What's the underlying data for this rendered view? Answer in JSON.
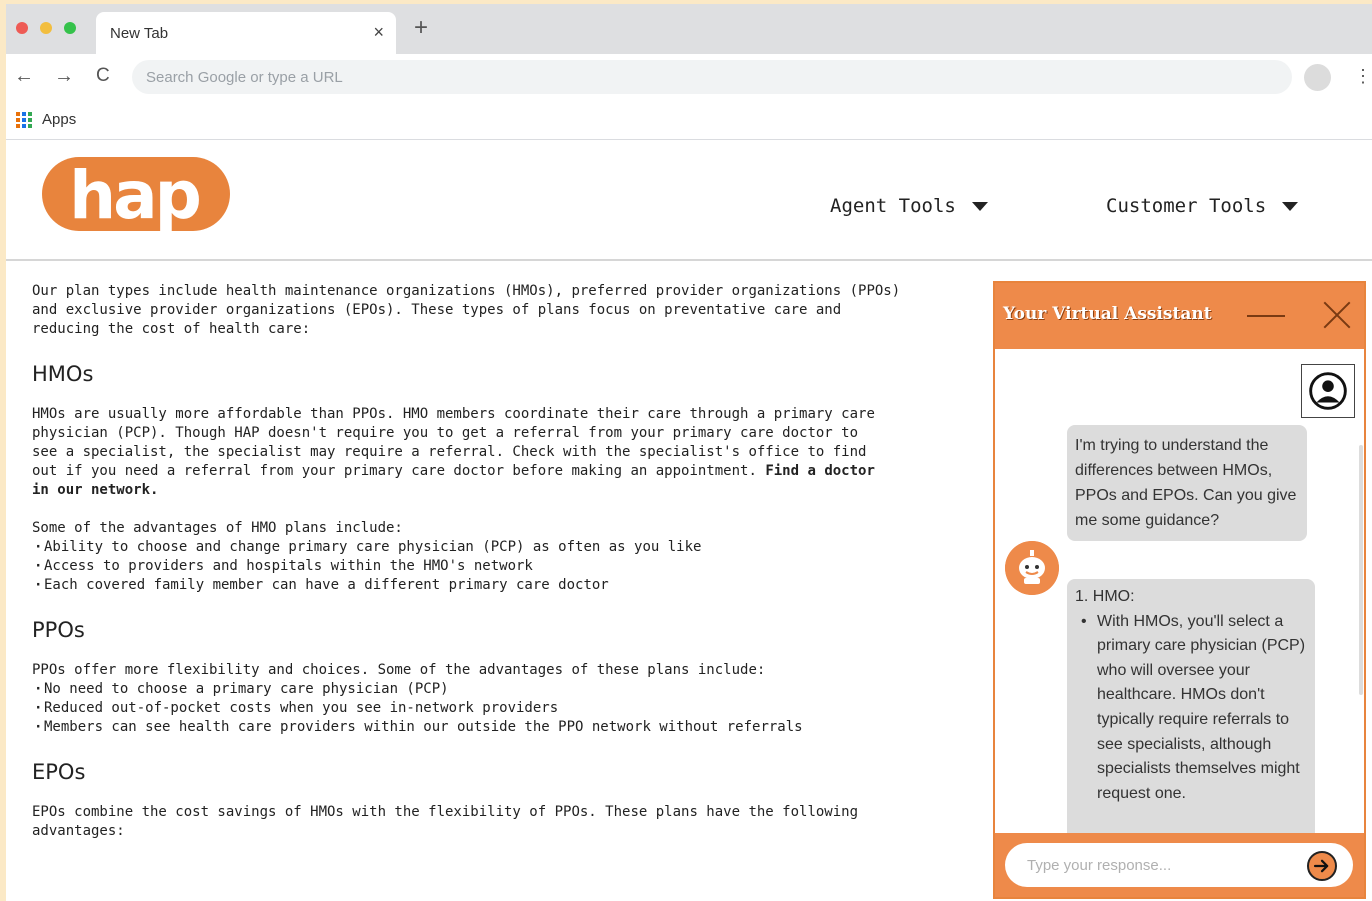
{
  "browser": {
    "tab_title": "New Tab",
    "tab_close": "×",
    "new_tab": "+",
    "back": "←",
    "forward": "→",
    "reload": "C",
    "omnibox_placeholder": "Search Google or type a URL",
    "menu": "⋮",
    "bookmarks_apps": "Apps"
  },
  "site": {
    "logo_text": "hap",
    "brand_color": "#ee8a4a",
    "nav": {
      "agent_tools": "Agent Tools",
      "customer_tools": "Customer Tools"
    }
  },
  "content": {
    "intro_lines": [
      "Our plan types include health maintenance organizations (HMOs), preferred provider organizations (PPOs)",
      "and exclusive provider organizations (EPOs).  These types of plans focus on preventative care and",
      "reducing the cost of health care:"
    ],
    "hmo": {
      "heading": "HMOs",
      "para_lines": [
        "HMOs are usually more affordable than PPOs.  HMO members coordinate their care through a primary care",
        "physician (PCP).  Though HAP doesn't require you to get a referral from your primary care doctor to",
        "see a specialist, the specialist may require a referral.  Check with the specialist's office to find",
        "out if you need a referral from your primary care doctor before making an appointment."
      ],
      "link_part1": "Find a doctor",
      "link_part2": "in our network.",
      "advantages_intro": "Some of the advantages of HMO plans include:",
      "advantages": [
        "Ability to choose and change primary care physician (PCP) as often as you like",
        "Access to providers and hospitals within the HMO's network",
        "Each covered family member can have a different primary care doctor"
      ]
    },
    "ppo": {
      "heading": "PPOs",
      "intro": "PPOs offer more flexibility and choices.  Some of the advantages of these plans include:",
      "advantages": [
        "No need to choose a primary care physician (PCP)",
        "Reduced out-of-pocket costs when you see in-network providers",
        "Members can see health care providers within our outside the PPO network without referrals"
      ]
    },
    "epo": {
      "heading": "EPOs",
      "para_lines": [
        "EPOs combine the cost savings of HMOs with the flexibility of PPOs.  These plans have the following",
        "advantages:"
      ]
    }
  },
  "chat": {
    "title": "Your Virtual Assistant",
    "user_message": "I'm trying to understand the differences between HMOs, PPOs and EPOs. Can you give me some guidance?",
    "bot_heading": "1. HMO:",
    "bot_bullet": "With HMOs, you'll select a primary care physician (PCP) who will oversee your healthcare. HMOs don't typically require referrals to see specialists, although specialists themselves might request one.",
    "input_placeholder": "Type your response..."
  }
}
